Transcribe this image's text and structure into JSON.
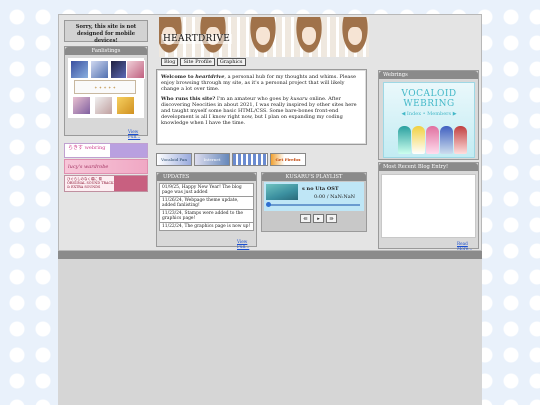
{
  "mobile_warning": "Sorry, this site is not designed for mobile devices!",
  "fanlistings": {
    "title": "Fanlistings",
    "view_full": "View Full..."
  },
  "side_buttons": [
    "らきす webring",
    "lucy's wardrobe",
    "ひぐらしのなく頃に 祭 ORIGINAL SOUND TRACK & EXTRA SOUNDS"
  ],
  "header": {
    "site_title": "HEARTDRIVE"
  },
  "nav": {
    "tabs": [
      "Blog",
      "Site Profile",
      "Graphics"
    ]
  },
  "welcome": {
    "p1_lead": "Welcome to ",
    "p1_site": "heartdrive",
    "p1_text": ", a personal hub for my thoughts and whims. Please enjoy browsing through my site, as it's a personal project that will likely change a lot over time.",
    "p2_lead": "Who runs this site?",
    "p2_text_a": " I'm an amateur who goes by ",
    "p2_name": "kusaru",
    "p2_text_b": " online. After discovering Neocities in about 2021, I was really inspired by other sites here and taught myself some basic HTML/CSS. Some bare-bones front-end development is all I know right now, but I plan on expanding my coding knowledge when I have the time."
  },
  "stamps": [
    "Vocaloid Fan",
    "Internet Explorer",
    "Get Firefox"
  ],
  "updates": {
    "title": "UPDATES",
    "items": [
      "01/9/25, Happy New Year! The blog page was just added",
      "11/26/24, Webpage theme update, added fanlisting!",
      "11/23/24, Stamps were added to the graphics page!",
      "11/22/24, The graphics page is now up!"
    ],
    "view_full": "View Full..."
  },
  "playlist": {
    "title": "KUSARU'S PLAYLIST",
    "song": "s no Uta OST",
    "time": "0:00 / NaN:NaN",
    "controls": [
      "prev",
      "play",
      "next"
    ]
  },
  "webrings": {
    "title": "Webrings",
    "vocaloid_title": "VOCALOID WEBRING",
    "vocaloid_links": "◀ Index • Members ▶"
  },
  "blog": {
    "title": "Most Recent Blog Entry!",
    "read_more": "Read More..."
  },
  "colors": {
    "panel_header": "#8a8a8a",
    "link": "#1a4fd0",
    "vocaloid": "#44b8c8"
  }
}
